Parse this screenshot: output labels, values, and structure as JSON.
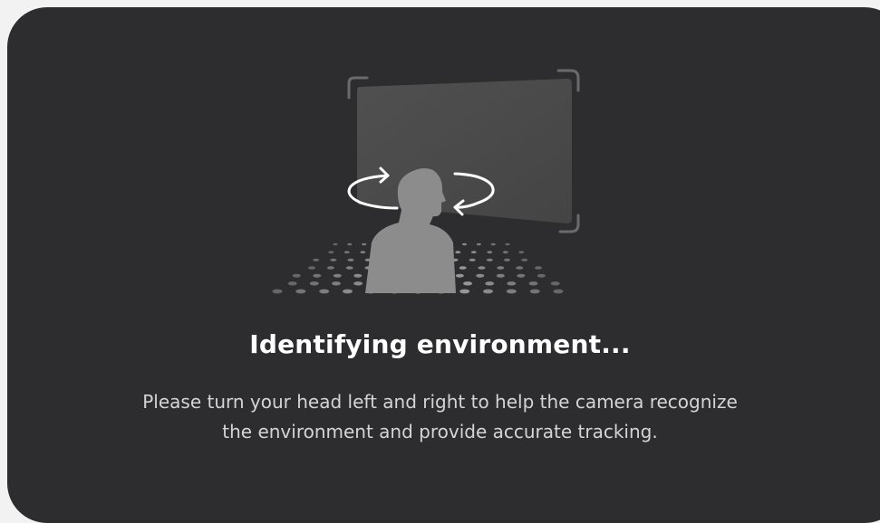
{
  "dialog": {
    "title": "Identifying environment...",
    "description_line1": "Please turn your head left and right to help the camera recognize",
    "description_line2": "the environment and provide accurate tracking."
  },
  "illustration": {
    "icons": [
      "screen-icon",
      "person-silhouette-icon",
      "rotate-left-arrow-icon",
      "rotate-right-arrow-icon",
      "floor-dots-icon"
    ]
  },
  "colors": {
    "card_background": "#2d2d2f",
    "page_background": "#f2f2f2",
    "title_text": "#ffffff",
    "body_text": "#d4d4d4",
    "screen": "#4a4a4a",
    "person": "#8a8a8a"
  }
}
